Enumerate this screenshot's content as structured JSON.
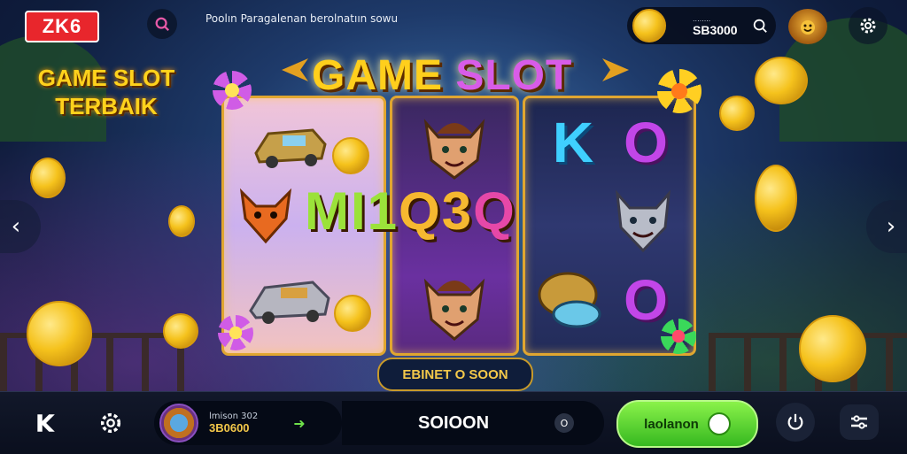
{
  "header": {
    "logo_text": "ZK6",
    "marquee_text": "Poolın Paragalenan berolnatıın sowu",
    "balance_label": "........",
    "balance_value": "SB3000"
  },
  "promo": {
    "line1": "GAME SLOT",
    "line2": "TERBAIK"
  },
  "title": {
    "word1": "GAME",
    "word2": "SLOT"
  },
  "reels": {
    "letters": [
      "K",
      "O",
      "O"
    ]
  },
  "middle_banner": {
    "part1": "MI1",
    "part2": "Q3",
    "part3": "Q"
  },
  "bonus_pill": "EBINET O SOON",
  "bottom": {
    "player_label": "lmison 302",
    "player_value": "3B0600",
    "bet_value": "SOIOON",
    "bet_info": "O",
    "spin_label": "laolanon"
  },
  "colors": {
    "accent_gold": "#f3c84a",
    "spin_green": "#36b820",
    "logo_red": "#e8262c"
  }
}
